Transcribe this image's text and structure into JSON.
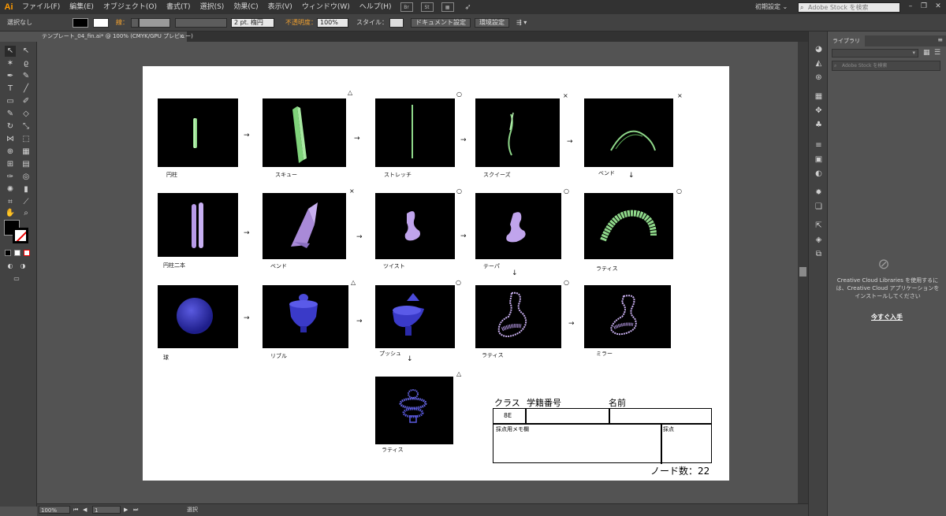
{
  "app": {
    "logo": "Ai",
    "accent": "#ff9a00"
  },
  "menubar": {
    "items": [
      "ファイル(F)",
      "編集(E)",
      "オブジェクト(O)",
      "書式(T)",
      "選択(S)",
      "効果(C)",
      "表示(V)",
      "ウィンドウ(W)",
      "ヘルプ(H)"
    ],
    "workspace": "初期設定",
    "stock_search_placeholder": "Adobe Stock を検索"
  },
  "controlbar": {
    "selection": "選択なし",
    "stroke_label": "線：",
    "stroke_weight": "2 pt. 楕円",
    "opacity_label": "不透明度：",
    "opacity_value": "100%",
    "style_label": "スタイル：",
    "doc_settings": "ドキュメント設定",
    "preferences": "環境設定"
  },
  "document_tab": {
    "title": "テンプレート_04_fin.ai* @ 100% (CMYK/GPU プレビュー)",
    "close": "×"
  },
  "artboard": {
    "rows": [
      {
        "items": [
          {
            "label": "円柱",
            "mark": ""
          },
          {
            "label": "スキュー",
            "mark": "△"
          },
          {
            "label": "ストレッチ",
            "mark": "○"
          },
          {
            "label": "スクイーズ",
            "mark": "×"
          },
          {
            "label": "ベンド",
            "mark": "×"
          }
        ]
      },
      {
        "items": [
          {
            "label": "円柱二本",
            "mark": "×"
          },
          {
            "label": "ベンド",
            "mark": ""
          },
          {
            "label": "ツイスト",
            "mark": "○"
          },
          {
            "label": "テーパ",
            "mark": "○"
          },
          {
            "label": "ラティス",
            "mark": "○"
          }
        ]
      },
      {
        "items": [
          {
            "label": "球",
            "mark": "△"
          },
          {
            "label": "リブル",
            "mark": ""
          },
          {
            "label": "プッシュ",
            "mark": "○"
          },
          {
            "label": "ラティス",
            "mark": "○"
          },
          {
            "label": "ミラー",
            "mark": ""
          }
        ]
      },
      {
        "items": [
          {
            "label": "ラティス",
            "mark": "△"
          }
        ]
      }
    ],
    "arrow_right": "→",
    "arrow_down": "↓",
    "table": {
      "class_label": "クラス",
      "student_id_label": "学籍番号",
      "name_label": "名前",
      "class_value": "8E",
      "memo_label": "採点用メモ欄",
      "score_label": "採点"
    },
    "node_count": "ノード数：22"
  },
  "statusbar": {
    "zoom": "100%",
    "page": "1",
    "tool": "選択"
  },
  "library_panel": {
    "tab": "ライブラリ",
    "search_placeholder": "Adobe Stock を検索",
    "message": "Creative Cloud Libraries を使用するには、Creative Cloud アプリケーションをインストールしてください",
    "get_now": "今すぐ入手"
  }
}
